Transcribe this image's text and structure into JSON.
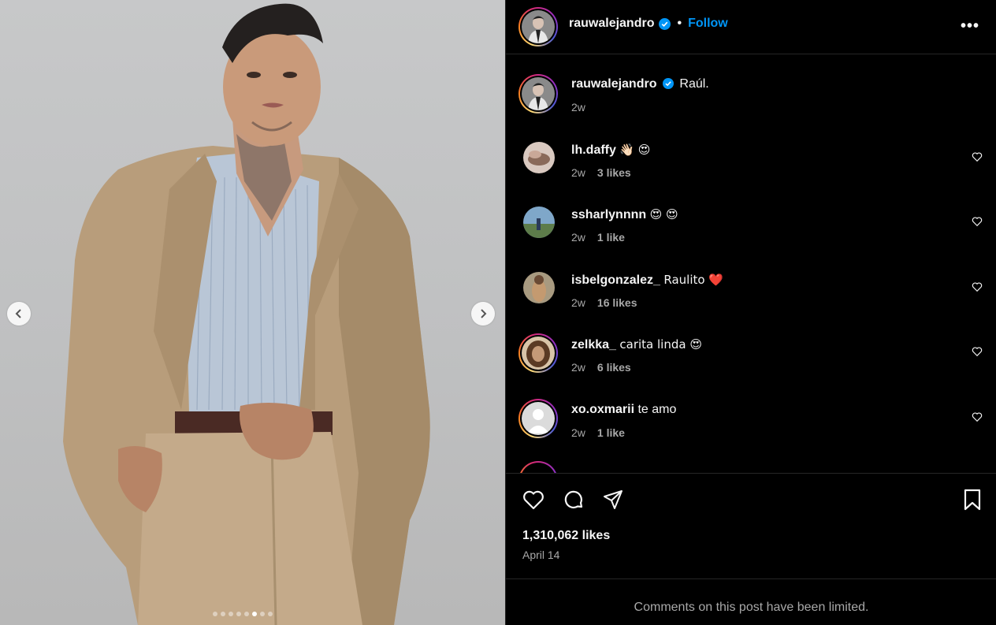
{
  "media": {
    "prev_icon": "chevron-left-icon",
    "next_icon": "chevron-right-icon",
    "slide_count": 8,
    "active_slide": 6
  },
  "header": {
    "username": "rauwalejandro",
    "separator": "•",
    "follow_label": "Follow",
    "more_label": "•••"
  },
  "caption": {
    "username": "rauwalejandro",
    "text": "Raúl.",
    "time": "2w"
  },
  "comments": [
    {
      "username": "lh.daffy",
      "text": "👋🏻 😍",
      "time": "2w",
      "likes": "3 likes"
    },
    {
      "username": "ssharlynnnn",
      "text": "😍 😍",
      "time": "2w",
      "likes": "1 like"
    },
    {
      "username": "isbelgonzalez_",
      "text": "Raulito ❤️",
      "time": "2w",
      "likes": "16 likes"
    },
    {
      "username": "zelkka_",
      "text": "carita linda 😍",
      "time": "2w",
      "likes": "6 likes"
    },
    {
      "username": "xo.oxmarii",
      "text": "te amo",
      "time": "2w",
      "likes": "1 like"
    }
  ],
  "actions": {
    "likes_total": "1,310,062 likes",
    "date": "April 14"
  },
  "footer": {
    "limited_text": "Comments on this post have been limited."
  },
  "colors": {
    "accent": "#0095f6",
    "verified": "#0095f6",
    "muted": "#a8a8a8",
    "background": "#000000"
  }
}
